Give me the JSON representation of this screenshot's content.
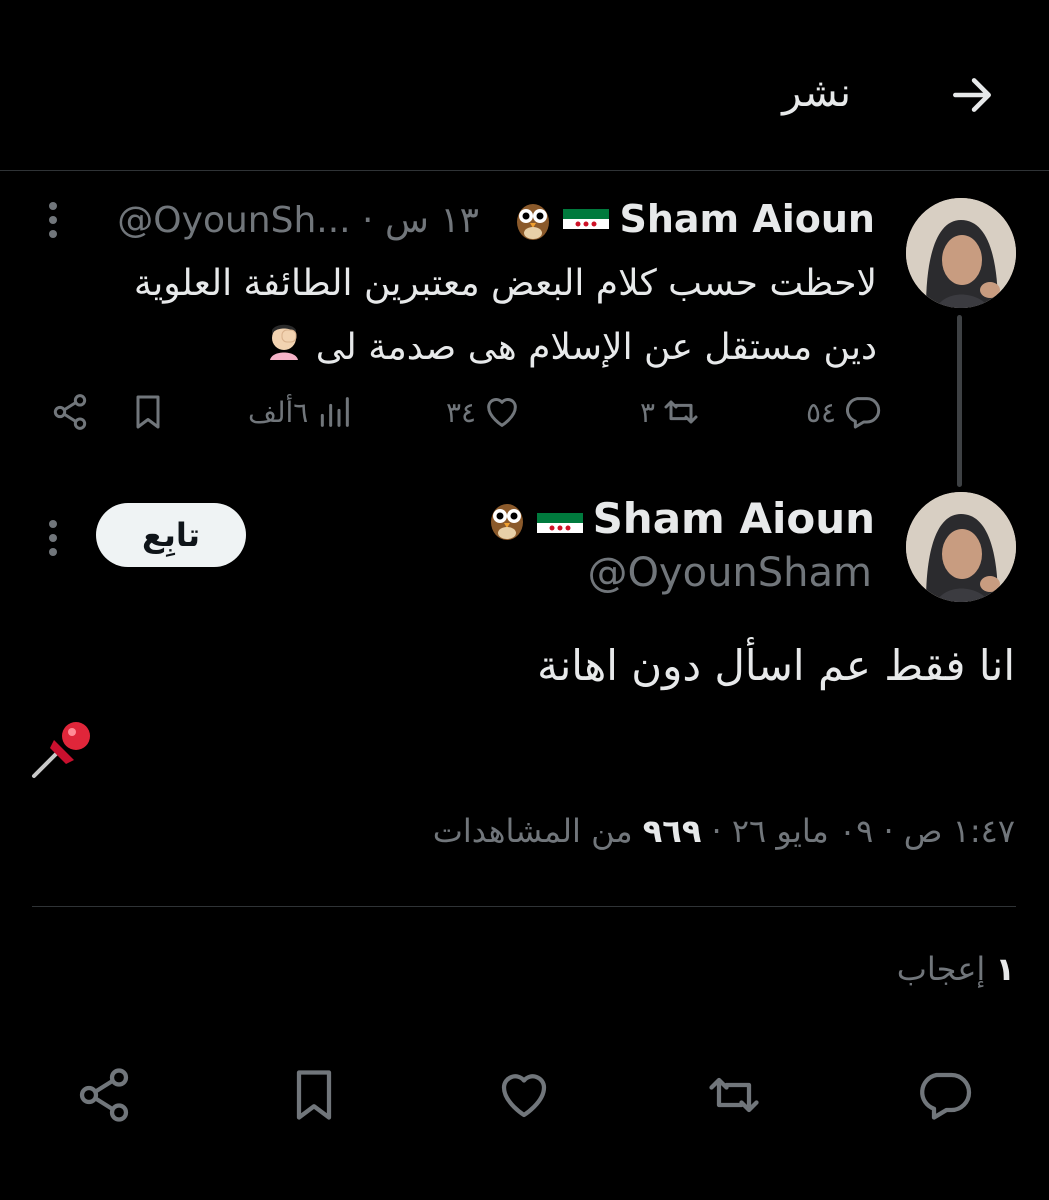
{
  "header": {
    "title": "نشر",
    "back_icon": "arrow-right-icon"
  },
  "parent_tweet": {
    "author_name": "Sham Aioun",
    "handle": "@OyounSh...",
    "time": "١٣ س",
    "text_line1": "لاحظت حسب كلام البعض معتبرين الطائفة العلوية",
    "text_line2": "دين مستقل عن الإسلام  هى صدمة لى",
    "actions": {
      "replies": "٥٤",
      "reposts": "٣",
      "likes": "٣٤",
      "views": "٦ألف"
    }
  },
  "main_tweet": {
    "author_name": "Sham Aioun",
    "handle": "@OyounSham",
    "follow_label": "تابِع",
    "text": "انا فقط عم اسأل دون اهانة",
    "meta_time": "١:٤٧ ص",
    "meta_date": "٠٩ مايو ٢٦",
    "meta_views_count": "٩٦٩",
    "meta_views_label": "من المشاهدات",
    "likes_count": "١",
    "likes_label": "إعجاب"
  },
  "colors": {
    "background": "#000000",
    "text": "#e7e9ea",
    "muted": "#71767b",
    "divider": "#2f3336"
  }
}
